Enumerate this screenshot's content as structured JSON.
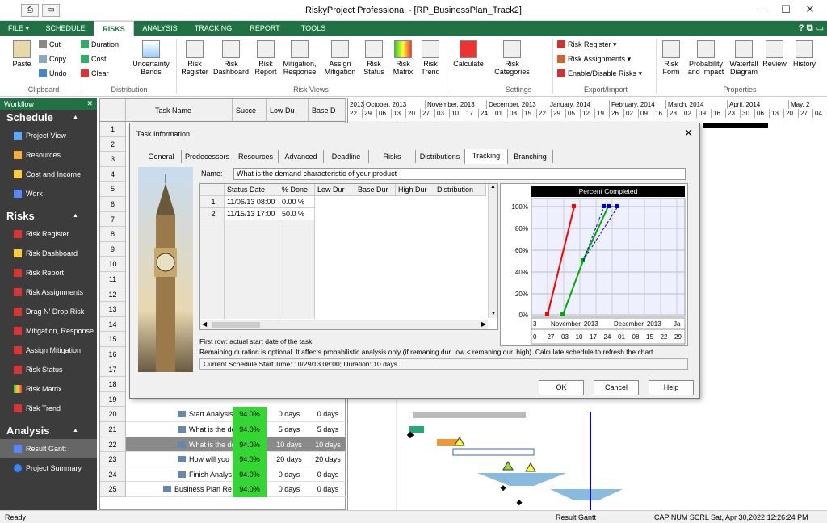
{
  "window": {
    "title": "RiskyProject Professional - [RP_BusinessPlan_Track2]"
  },
  "tabs": [
    {
      "label": "FILE"
    },
    {
      "label": "SCHEDULE"
    },
    {
      "label": "RISKS"
    },
    {
      "label": "ANALYSIS"
    },
    {
      "label": "TRACKING"
    },
    {
      "label": "REPORT"
    },
    {
      "label": "TOOLS"
    }
  ],
  "help_label": "?",
  "ribbon": {
    "paste": "Paste",
    "cut": "Cut",
    "copy": "Copy",
    "undo": "Undo",
    "clipboard": "Clipboard",
    "duration": "Duration",
    "cost": "Cost",
    "clear": "Clear",
    "uncertainty": "Uncertainty Bands",
    "distribution": "Distribution",
    "risk_views": [
      {
        "label": "Risk Register"
      },
      {
        "label": "Risk Dashboard"
      },
      {
        "label": "Risk Report"
      },
      {
        "label": "Mitigation, Response"
      },
      {
        "label": "Assign Mitigation"
      },
      {
        "label": "Risk Status"
      },
      {
        "label": "Risk Matrix"
      },
      {
        "label": "Risk Trend"
      }
    ],
    "risk_views_group": "Risk Views",
    "calculate": "Calculate",
    "risk_categories": "Risk Categories",
    "settings": "Settings",
    "export": [
      "Risk Register",
      "Risk Assignments",
      "Enable/Disable Risks"
    ],
    "export_group": "Export/Import",
    "props": [
      {
        "label": "Risk Form"
      },
      {
        "label": "Probability and Impact"
      },
      {
        "label": "Waterfall Diagram"
      },
      {
        "label": "Review"
      },
      {
        "label": "History"
      }
    ],
    "props_group": "Properties"
  },
  "workflow": {
    "title": "Workflow",
    "close": "✕",
    "schedule": "Schedule",
    "schedule_items": [
      "Project View",
      "Resources",
      "Cost and Income",
      "Work"
    ],
    "risks": "Risks",
    "risk_items": [
      "Risk Register",
      "Risk Dashboard",
      "Risk Report",
      "Risk Assignments",
      "Drag N' Drop Risk",
      "Mitigation, Response",
      "Assign Mitigation",
      "Risk Status",
      "Risk Matrix",
      "Risk Trend"
    ],
    "analysis": "Analysis",
    "analysis_items": [
      "Result Gantt",
      "Project Summary"
    ]
  },
  "grid": {
    "cols": [
      "Task Name",
      "Succe",
      "Low Du",
      "Base D"
    ],
    "rows": [
      "1",
      "2",
      "3",
      "4",
      "5",
      "6",
      "7",
      "8",
      "9",
      "10",
      "11",
      "12",
      "13",
      "14",
      "15",
      "16",
      "17",
      "18",
      "19",
      "20",
      "21",
      "22",
      "23",
      "24",
      "25"
    ],
    "tasks": [
      {
        "n": "20",
        "name": "Start Analysis",
        "pct": "94.0%",
        "low": "0 days",
        "base": "0 days"
      },
      {
        "n": "21",
        "name": "What is the de",
        "pct": "94.0%",
        "low": "5 days",
        "base": "5 days"
      },
      {
        "n": "22",
        "name": "What is the de",
        "pct": "94.0%",
        "low": "10 days",
        "base": "10 days"
      },
      {
        "n": "23",
        "name": "How will you",
        "pct": "94.0%",
        "low": "20 days",
        "base": "20 days"
      },
      {
        "n": "24",
        "name": "Finish Analys",
        "pct": "94.0%",
        "low": "0 days",
        "base": "0 days"
      },
      {
        "n": "25",
        "name": "Business Plan Re",
        "pct": "94.0%",
        "low": "0 days",
        "base": "0 days"
      }
    ]
  },
  "gantt": {
    "months": [
      "2013",
      "October, 2013",
      "November, 2013",
      "December, 2013",
      "January, 2014",
      "February, 2014",
      "March, 2014",
      "April, 2014",
      "May, 2"
    ],
    "days": [
      "22",
      "29",
      "06",
      "13",
      "20",
      "27",
      "03",
      "10",
      "17",
      "24",
      "01",
      "08",
      "15",
      "22",
      "29",
      "05",
      "12",
      "19",
      "26",
      "02",
      "09",
      "16",
      "23",
      "02",
      "09",
      "16",
      "23",
      "30",
      "06",
      "13",
      "20",
      "27",
      "04"
    ]
  },
  "dialog": {
    "title": "Task Information",
    "close": "✕",
    "tabs": [
      "General",
      "Predecessors",
      "Resources",
      "Advanced",
      "Deadline",
      "Risks",
      "Distributions",
      "Tracking",
      "Branching"
    ],
    "name_label": "Name:",
    "name_value": "What is the demand characteristic of your product",
    "table_cols": [
      "Status Date",
      "% Done",
      "Low Dur",
      "Base Dur",
      "High Dur",
      "Distribution"
    ],
    "table_rows": [
      {
        "n": "1",
        "date": "11/06/13 08:00",
        "pct": "0.00 %"
      },
      {
        "n": "2",
        "date": "11/15/13 17:00",
        "pct": "50.0 %"
      }
    ],
    "chart_title": "Percent Completed",
    "chart_y": [
      "100%",
      "80%",
      "60%",
      "40%",
      "20%",
      "0%"
    ],
    "chart_x_months": [
      "3",
      "November, 2013",
      "December, 2013",
      "Ja"
    ],
    "chart_x_days": [
      "0",
      "27",
      "03",
      "10",
      "17",
      "24",
      "01",
      "08",
      "15",
      "22",
      "29"
    ],
    "note1": "First row: actual start date of the task",
    "note2": "Remaining duration is optional. It affects probabilistic analysis only (if remaning dur. low < remaning dur. high). Calculate schedule to refresh the chart.",
    "status": "Current Schedule Start Time: 10/29/13 08:00;    Duration: 10 days",
    "ok": "OK",
    "cancel": "Cancel",
    "help": "Help"
  },
  "statusbar": {
    "left": "Ready",
    "mid": "Result Gantt",
    "right": "CAP  NUM  SCRL  Sat, Apr 30,2022   12:26:24 PM"
  }
}
